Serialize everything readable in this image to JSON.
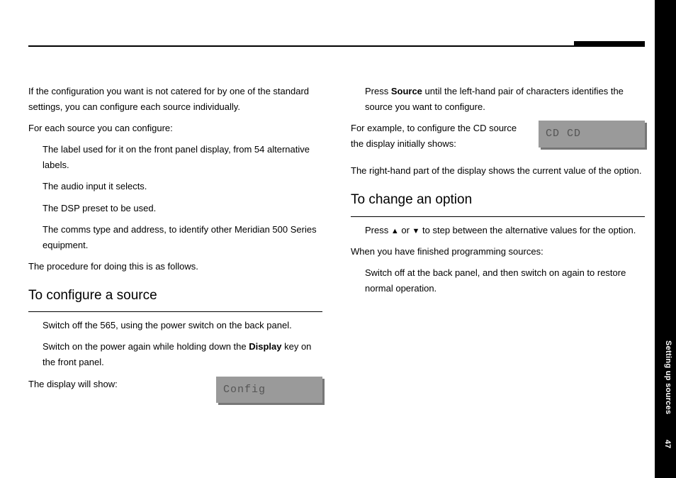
{
  "sideLabel": "Setting up sources",
  "pageNumber": "47",
  "left": {
    "intro": "If the configuration you want is not catered for by one of the standard settings, you can configure each source individually.",
    "eachSourceLead": "For each source you can configure:",
    "bullets": {
      "b1": "The label used for it on the front panel display, from 54 alternative labels.",
      "b2": "The audio input it selects.",
      "b3": "The DSP preset to be used.",
      "b4": "The comms type and address, to identify other Meridian 500 Series equipment."
    },
    "procedure": "The procedure for doing this is as follows.",
    "h1": "To configure a source",
    "step1": "Switch off the 565, using the power switch on the back panel.",
    "step2a": "Switch on the power again while holding down the ",
    "step2bold": "Display",
    "step2b": " key on the front panel.",
    "displayShow": "The display will show:",
    "lcd1": "Config"
  },
  "right": {
    "press1a": "Press ",
    "press1bold": "Source",
    "press1b": " until the left-hand pair of characters identifies the source you want to configure.",
    "example": "For example, to configure the CD source the display initially shows:",
    "lcd2": "CD CD",
    "rightPart": "The right-hand part of the display shows the current value of the option.",
    "h2": "To change an option",
    "press2a": "Press ",
    "tri1": "▲",
    "press2mid": " or ",
    "tri2": "▼",
    "press2b": " to step between the alternative values for the option.",
    "finished": "When you have finished programming sources:",
    "switchOff": "Switch off at the back panel, and then switch on again to restore normal operation."
  }
}
